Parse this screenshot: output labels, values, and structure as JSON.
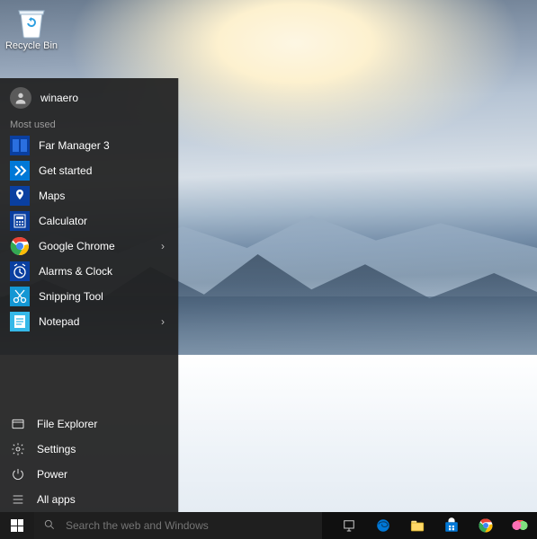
{
  "desktop": {
    "recycle_bin_label": "Recycle Bin"
  },
  "start_menu": {
    "user_name": "winaero",
    "most_used_label": "Most used",
    "apps": [
      {
        "label": "Far Manager 3",
        "icon": "far",
        "color": "#0a3fa0",
        "expandable": false
      },
      {
        "label": "Get started",
        "icon": "getstarted",
        "color": "#0078d7",
        "expandable": false
      },
      {
        "label": "Maps",
        "icon": "maps",
        "color": "#0a3fa0",
        "expandable": false
      },
      {
        "label": "Calculator",
        "icon": "calc",
        "color": "#0a3fa0",
        "expandable": false
      },
      {
        "label": "Google Chrome",
        "icon": "chrome",
        "color": "transparent",
        "expandable": true
      },
      {
        "label": "Alarms & Clock",
        "icon": "alarms",
        "color": "#0a3fa0",
        "expandable": false
      },
      {
        "label": "Snipping Tool",
        "icon": "snip",
        "color": "#1497d4",
        "expandable": false
      },
      {
        "label": "Notepad",
        "icon": "notepad",
        "color": "#35b8e8",
        "expandable": true
      }
    ],
    "sys": {
      "file_explorer": "File Explorer",
      "settings": "Settings",
      "power": "Power",
      "all_apps": "All apps"
    }
  },
  "taskbar": {
    "search_placeholder": "Search the web and Windows"
  }
}
